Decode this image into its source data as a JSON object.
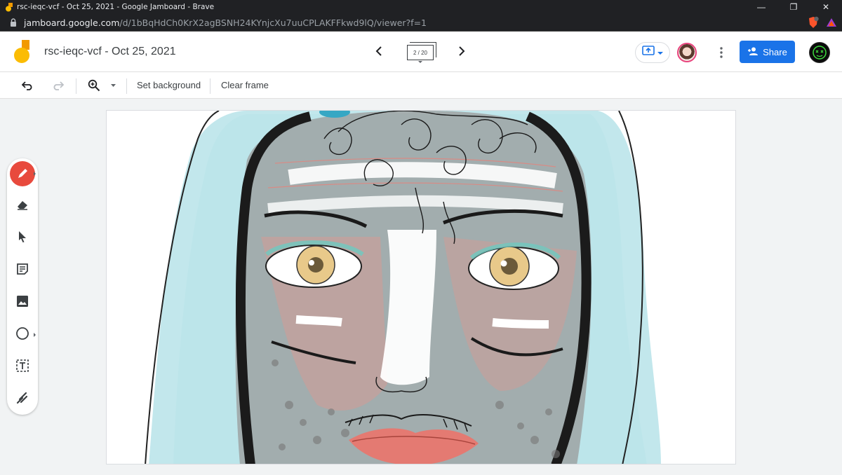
{
  "window": {
    "title": "rsc-ieqc-vcf - Oct 25, 2021 - Google Jamboard - Brave",
    "minimize": "—",
    "restore": "❐",
    "close": "✕"
  },
  "address": {
    "host": "jamboard.google.com",
    "path": "/d/1bBqHdCh0KrX2agBSNH24KYnjcXu7uuCPLAKFFkwd9lQ/viewer?f=1"
  },
  "header": {
    "doc_title": "rsc-ieqc-vcf - Oct 25, 2021",
    "frame_indicator": "2 / 20",
    "share_label": "Share"
  },
  "toolbar": {
    "set_background": "Set background",
    "clear_frame": "Clear frame"
  },
  "colors": {
    "accent": "#1a73e8",
    "pen_active": "#e84a3d",
    "logo_yellow": "#fbbc04",
    "logo_orange": "#f29900",
    "avatar_ring": "#e8437d"
  },
  "palette": {
    "tools": [
      "pen-icon",
      "eraser-icon",
      "select-icon",
      "sticky-note-icon",
      "image-icon",
      "circle-icon",
      "text-box-icon",
      "laser-icon"
    ]
  }
}
